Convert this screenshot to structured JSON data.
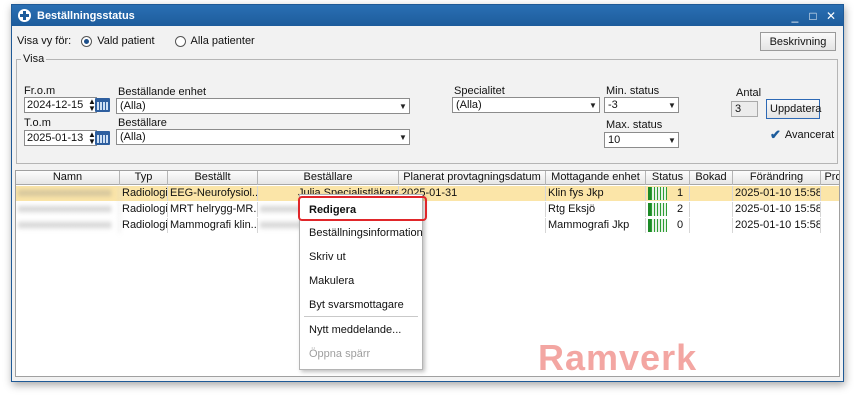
{
  "window": {
    "title": "Beställningsstatus",
    "minimize": "_",
    "maximize": "□",
    "close": "✕"
  },
  "view_for": {
    "label": "Visa vy för:",
    "options": [
      {
        "label": "Vald patient",
        "selected": true
      },
      {
        "label": "Alla patienter",
        "selected": false
      }
    ]
  },
  "buttons": {
    "beskrivning": "Beskrivning",
    "uppdatera": "Uppdatera"
  },
  "filters": {
    "group_label": "Visa",
    "from_label": "Fr.o.m",
    "from_value": "2024-12-15",
    "to_label": "T.o.m",
    "to_value": "2025-01-13",
    "unit_label": "Beställande enhet",
    "unit_value": "(Alla)",
    "orderer_label": "Beställare",
    "orderer_value": "(Alla)",
    "specialty_label": "Specialitet",
    "specialty_value": "(Alla)",
    "min_status_label": "Min. status",
    "min_status_value": "-3",
    "max_status_label": "Max. status",
    "max_status_value": "10",
    "count_label": "Antal",
    "count_value": "3",
    "advanced_label": "Avancerat",
    "advanced_checked": true
  },
  "table": {
    "columns": [
      "Namn",
      "Typ",
      "Beställt",
      "Beställare",
      "Planerat provtagningsdatum",
      "Mottagande enhet",
      "Status",
      "Bokad",
      "Förändring",
      "Pro"
    ],
    "rows": [
      {
        "name": "xxxxxxxxxxxxxxxxx",
        "type": "Radiologi",
        "ordered": "EEG-Neurofysiol...",
        "orderer": "Julia Specialistläkare",
        "planned": "2025-01-31",
        "receiving": "Klin fys Jkp",
        "status": "1",
        "booked": "",
        "changed": "2025-01-10 15:58",
        "selected": true
      },
      {
        "name": "xxxxxxxxxxxxxxxxx",
        "type": "Radiologi",
        "ordered": "MRT helrygg-MR...",
        "orderer": "xxxxxxxxxx",
        "planned": "",
        "receiving": "Rtg Eksjö",
        "status": "2",
        "booked": "",
        "changed": "2025-01-10 15:58",
        "selected": false
      },
      {
        "name": "xxxxxxxxxxxxxxxxx",
        "type": "Radiologi",
        "ordered": "Mammografi klin...",
        "orderer": "xxxxxxxxxx",
        "planned": "",
        "receiving": "Mammografi Jkp",
        "status": "0",
        "booked": "",
        "changed": "2025-01-10 15:58",
        "selected": false
      }
    ]
  },
  "context_menu": {
    "items": [
      "Redigera",
      "Beställningsinformation",
      "Skriv ut",
      "Makulera",
      "Byt svarsmottagare",
      "Nytt meddelande...",
      "Öppna spärr"
    ]
  },
  "watermark": "Ramverk",
  "colors": {
    "titlebar": "#1d5c9c",
    "selected_row": "#fbe5a8",
    "highlight": "#e0262a",
    "status_green": "#2e9d35"
  }
}
